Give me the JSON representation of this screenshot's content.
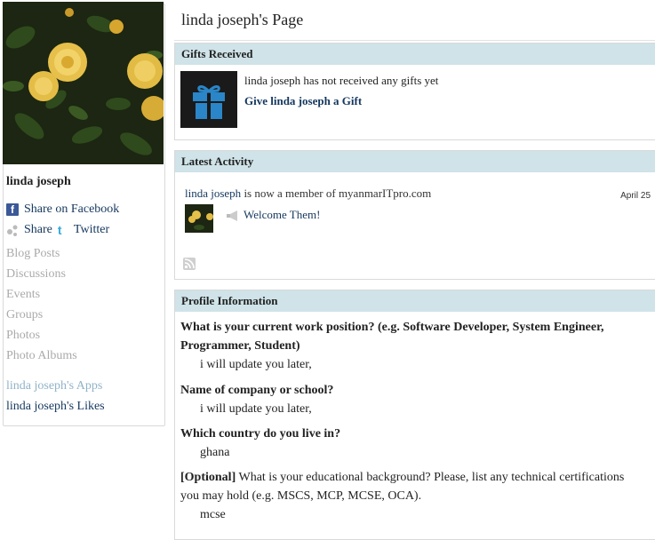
{
  "profile": {
    "name": "linda joseph",
    "share_facebook": "Share on Facebook",
    "share": "Share",
    "twitter": "Twitter",
    "menu": [
      "Blog Posts",
      "Discussions",
      "Events",
      "Groups",
      "Photos",
      "Photo Albums"
    ],
    "apps_link": "linda joseph's Apps",
    "likes_link": "linda joseph's Likes"
  },
  "page": {
    "title": "linda joseph's Page"
  },
  "gifts": {
    "heading": "Gifts Received",
    "message": "linda joseph has not received any gifts yet",
    "give_link": "Give linda joseph a Gift"
  },
  "activity": {
    "heading": "Latest Activity",
    "user": "linda joseph",
    "text": " is now a member of myanmarITpro.com",
    "date": "April 25",
    "welcome": "Welcome Them!"
  },
  "profile_info": {
    "heading": "Profile Information",
    "q1": "What is your current work position? (e.g. Software Developer, System Engineer, Programmer, Student)",
    "a1": "i will update you later,",
    "q2": "Name of company or school?",
    "a2": "i will update you later,",
    "q3": "Which country do you live in?",
    "a3": "ghana",
    "q4_prefix": "[Optional]",
    "q4": " What is your educational background? Please, list any technical certifications you may hold (e.g. MSCS, MCP, MCSE, OCA).",
    "a4": "mcse"
  },
  "colors": {
    "link": "#14375e",
    "header_bg": "#cfe3e8",
    "muted": "#aaaaaa",
    "facebook": "#3b5998",
    "twitter": "#33aadd",
    "gift": "#2a86c8"
  }
}
